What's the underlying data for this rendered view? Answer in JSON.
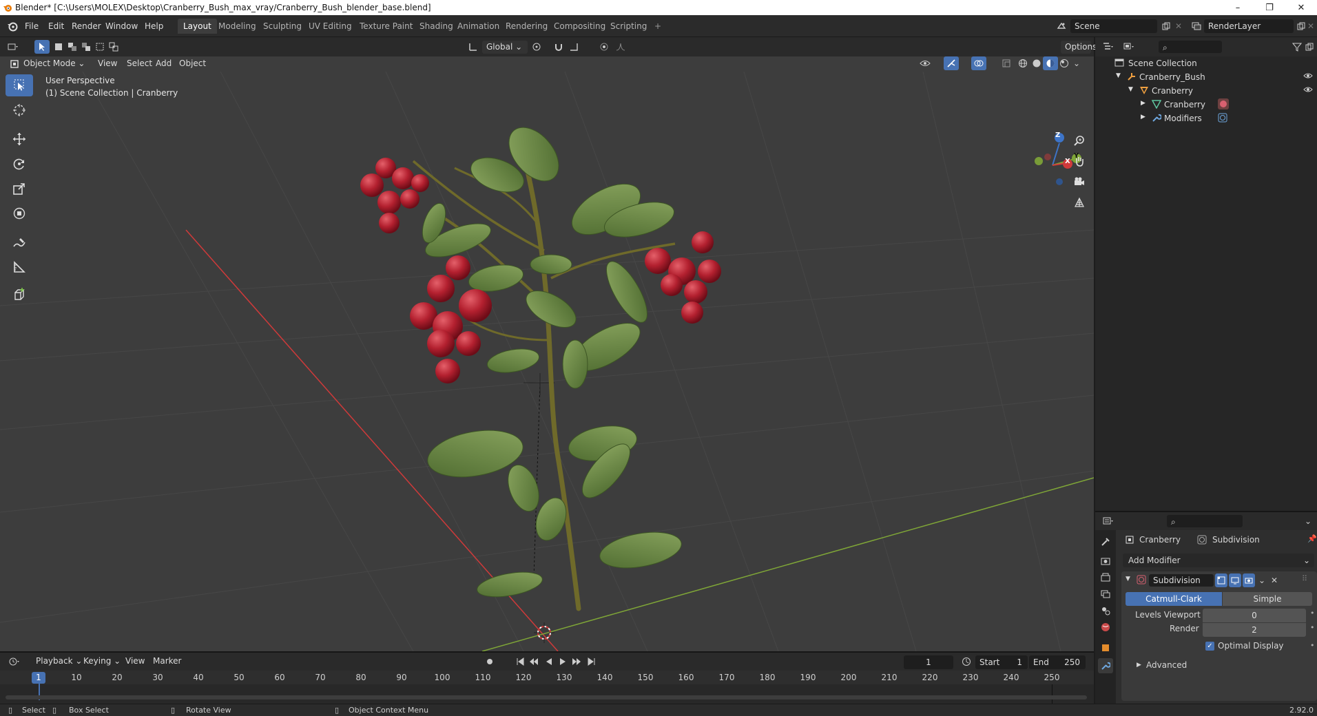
{
  "window": {
    "title": "Blender* [C:\\Users\\MOLEX\\Desktop\\Cranberry_Bush_max_vray/Cranberry_Bush_blender_base.blend]",
    "minimize": "–",
    "maximize": "❐",
    "close": "✕"
  },
  "menu": [
    "File",
    "Edit",
    "Render",
    "Window",
    "Help"
  ],
  "workspaces": [
    "Layout",
    "Modeling",
    "Sculpting",
    "UV Editing",
    "Texture Paint",
    "Shading",
    "Animation",
    "Rendering",
    "Compositing",
    "Scripting"
  ],
  "workspace_add": "+",
  "scene": {
    "name": "Scene",
    "view_layer": "RenderLayer"
  },
  "viewport_header": {
    "mode": "Object Mode",
    "menus": [
      "View",
      "Select",
      "Add",
      "Object"
    ],
    "transform_orientation": "Global",
    "options": "Options"
  },
  "viewport": {
    "perspective": "User Perspective",
    "collection_info": "(1) Scene Collection | Cranberry",
    "gizmo": {
      "z": "Z",
      "y": "Y",
      "x": "X"
    }
  },
  "outliner": {
    "rows": [
      {
        "label": "Scene Collection",
        "icon": "collection-icon"
      },
      {
        "label": "Cranberry_Bush",
        "icon": "armature-icon"
      },
      {
        "label": "Cranberry",
        "icon": "object-icon"
      },
      {
        "label": "Cranberry",
        "icon": "mesh-icon"
      },
      {
        "label": "Modifiers",
        "icon": "wrench-icon"
      }
    ]
  },
  "properties": {
    "breadcrumb_object": "Cranberry",
    "breadcrumb_modifier": "Subdivision",
    "add_modifier": "Add Modifier",
    "modifier": {
      "name": "Subdivision",
      "type_options": [
        "Catmull-Clark",
        "Simple"
      ],
      "selected_type": "Catmull-Clark",
      "levels_viewport_label": "Levels Viewport",
      "levels_viewport": "0",
      "render_label": "Render",
      "render": "2",
      "optimal_display_label": "Optimal Display",
      "optimal_display": true,
      "advanced_label": "Advanced"
    }
  },
  "timeline": {
    "menus": [
      "Playback",
      "Keying",
      "View",
      "Marker"
    ],
    "current_frame": "1",
    "start_label": "Start",
    "start": "1",
    "end_label": "End",
    "end": "250",
    "ticks": [
      "10",
      "20",
      "30",
      "40",
      "50",
      "60",
      "70",
      "80",
      "90",
      "100",
      "110",
      "120",
      "130",
      "140",
      "150",
      "160",
      "170",
      "180",
      "190",
      "200",
      "210",
      "220",
      "230",
      "240",
      "250"
    ]
  },
  "statusbar": {
    "select": "Select",
    "box_select": "Box Select",
    "rotate_view": "Rotate View",
    "context_menu": "Object Context Menu",
    "version": "2.92.0"
  },
  "colors": {
    "accent": "#4772b3",
    "axis_x": "#d03a3a",
    "axis_y": "#7fa637",
    "berry": "#b3202f",
    "leaf": "#5f7e3c",
    "stem": "#6f6a2a"
  }
}
